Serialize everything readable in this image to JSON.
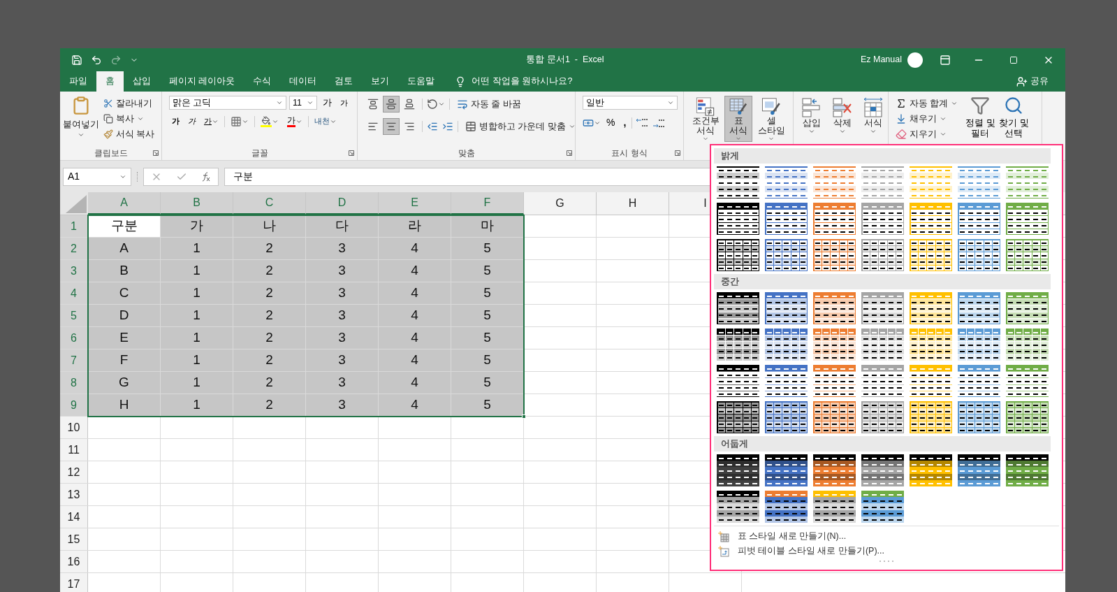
{
  "window": {
    "title": "통합 문서1  -  Excel",
    "user": "Ez Manual"
  },
  "tabs": [
    {
      "label": "파일",
      "selected": false
    },
    {
      "label": "홈",
      "selected": true
    },
    {
      "label": "삽입",
      "selected": false
    },
    {
      "label": "페이지 레이아웃",
      "selected": false
    },
    {
      "label": "수식",
      "selected": false
    },
    {
      "label": "데이터",
      "selected": false
    },
    {
      "label": "검토",
      "selected": false
    },
    {
      "label": "보기",
      "selected": false
    },
    {
      "label": "도움말",
      "selected": false
    }
  ],
  "tell_me": "어떤 작업을 원하시나요?",
  "share": "공유",
  "clipboard": {
    "label": "클립보드",
    "paste": "붙여넣기",
    "cut": "잘라내기",
    "copy": "복사",
    "format_painter": "서식 복사"
  },
  "font": {
    "label": "글꼴",
    "name": "맑은 고딕",
    "size": "11",
    "grow": "가",
    "shrink": "가",
    "bold": "가",
    "italic": "가",
    "underline": "가",
    "font_color": "가",
    "phonetic": "내천"
  },
  "alignment": {
    "label": "맞춤",
    "vertical": [
      {
        "kind": "top",
        "selected": false
      },
      {
        "kind": "middle",
        "selected": true
      },
      {
        "kind": "bottom",
        "selected": false
      }
    ],
    "horizontal": [
      {
        "kind": "left",
        "selected": false
      },
      {
        "kind": "center",
        "selected": true
      },
      {
        "kind": "right",
        "selected": false
      }
    ],
    "wrap": "자동 줄 바꿈",
    "merge": "병합하고 가운데 맞춤"
  },
  "number": {
    "label": "표시 형식",
    "format": "일반",
    "percent": "%",
    "comma": ","
  },
  "styles": [
    {
      "kind": "conditional",
      "label": "조건부 서식",
      "selected": false
    },
    {
      "kind": "table",
      "label": "표 서식",
      "selected": true
    },
    {
      "kind": "cell",
      "label": "셀 스타일",
      "selected": false
    }
  ],
  "cells": [
    {
      "kind": "insert",
      "label": "삽입"
    },
    {
      "kind": "delete",
      "label": "삭제"
    },
    {
      "kind": "format",
      "label": "서식"
    }
  ],
  "editing": {
    "autosum": "자동 합계",
    "fill": "채우기",
    "clear": "지우기",
    "sort": "정렬 및 필터",
    "find": "찾기 및 선택"
  },
  "name_box": "A1",
  "formula": "구분",
  "sheet": {
    "columns": [
      {
        "label": "A",
        "selected": true
      },
      {
        "label": "B",
        "selected": true
      },
      {
        "label": "C",
        "selected": true
      },
      {
        "label": "D",
        "selected": true
      },
      {
        "label": "E",
        "selected": true
      },
      {
        "label": "F",
        "selected": true
      },
      {
        "label": "G",
        "selected": false
      },
      {
        "label": "H",
        "selected": false
      },
      {
        "label": "I",
        "selected": false
      }
    ],
    "rows": [
      {
        "header": "1",
        "selected": true,
        "cells": [
          "구분",
          "가",
          "나",
          "다",
          "라",
          "마"
        ]
      },
      {
        "header": "2",
        "selected": true,
        "cells": [
          "A",
          "1",
          "2",
          "3",
          "4",
          "5"
        ]
      },
      {
        "header": "3",
        "selected": true,
        "cells": [
          "B",
          "1",
          "2",
          "3",
          "4",
          "5"
        ]
      },
      {
        "header": "4",
        "selected": true,
        "cells": [
          "C",
          "1",
          "2",
          "3",
          "4",
          "5"
        ]
      },
      {
        "header": "5",
        "selected": true,
        "cells": [
          "D",
          "1",
          "2",
          "3",
          "4",
          "5"
        ]
      },
      {
        "header": "6",
        "selected": true,
        "cells": [
          "E",
          "1",
          "2",
          "3",
          "4",
          "5"
        ]
      },
      {
        "header": "7",
        "selected": true,
        "cells": [
          "F",
          "1",
          "2",
          "3",
          "4",
          "5"
        ]
      },
      {
        "header": "8",
        "selected": true,
        "cells": [
          "G",
          "1",
          "2",
          "3",
          "4",
          "5"
        ]
      },
      {
        "header": "9",
        "selected": true,
        "cells": [
          "H",
          "1",
          "2",
          "3",
          "4",
          "5"
        ]
      },
      {
        "header": "10",
        "selected": false
      },
      {
        "header": "11",
        "selected": false
      },
      {
        "header": "12",
        "selected": false
      },
      {
        "header": "13",
        "selected": false
      },
      {
        "header": "14",
        "selected": false
      },
      {
        "header": "15",
        "selected": false
      },
      {
        "header": "16",
        "selected": false
      },
      {
        "header": "17",
        "selected": false
      }
    ]
  },
  "gallery": {
    "sections": [
      {
        "title": "밝게",
        "styles": [
          {
            "kind": "light-banded",
            "color": "#000000"
          },
          {
            "kind": "light-banded",
            "color": "#4472c4"
          },
          {
            "kind": "light-banded",
            "color": "#ed7d31"
          },
          {
            "kind": "light-banded",
            "color": "#a5a5a5"
          },
          {
            "kind": "light-banded",
            "color": "#ffc000"
          },
          {
            "kind": "light-banded",
            "color": "#5b9bd5"
          },
          {
            "kind": "light-banded",
            "color": "#70ad47"
          },
          {
            "kind": "light-header",
            "color": "#000000"
          },
          {
            "kind": "light-header",
            "color": "#4472c4"
          },
          {
            "kind": "light-header",
            "color": "#ed7d31"
          },
          {
            "kind": "light-header",
            "color": "#a5a5a5"
          },
          {
            "kind": "light-header",
            "color": "#ffc000"
          },
          {
            "kind": "light-header",
            "color": "#5b9bd5"
          },
          {
            "kind": "light-header",
            "color": "#70ad47"
          },
          {
            "kind": "light-grid",
            "color": "#000000"
          },
          {
            "kind": "light-grid",
            "color": "#4472c4"
          },
          {
            "kind": "light-grid",
            "color": "#ed7d31"
          },
          {
            "kind": "light-grid",
            "color": "#a5a5a5"
          },
          {
            "kind": "light-grid",
            "color": "#ffc000"
          },
          {
            "kind": "light-grid",
            "color": "#5b9bd5"
          },
          {
            "kind": "light-grid",
            "color": "#70ad47"
          }
        ]
      },
      {
        "title": "중간",
        "styles": [
          {
            "kind": "medium-banded",
            "color": "#000000"
          },
          {
            "kind": "medium-banded",
            "color": "#4472c4"
          },
          {
            "kind": "medium-banded",
            "color": "#ed7d31"
          },
          {
            "kind": "medium-banded",
            "color": "#a5a5a5"
          },
          {
            "kind": "medium-banded",
            "color": "#ffc000"
          },
          {
            "kind": "medium-banded",
            "color": "#5b9bd5"
          },
          {
            "kind": "medium-banded",
            "color": "#70ad47"
          },
          {
            "kind": "medium-grid",
            "color": "#000000"
          },
          {
            "kind": "medium-grid",
            "color": "#4472c4"
          },
          {
            "kind": "medium-grid",
            "color": "#ed7d31"
          },
          {
            "kind": "medium-grid",
            "color": "#a5a5a5"
          },
          {
            "kind": "medium-grid",
            "color": "#ffc000"
          },
          {
            "kind": "medium-grid",
            "color": "#5b9bd5"
          },
          {
            "kind": "medium-grid",
            "color": "#70ad47"
          },
          {
            "kind": "medium-lines",
            "color": "#000000"
          },
          {
            "kind": "medium-lines",
            "color": "#4472c4"
          },
          {
            "kind": "medium-lines",
            "color": "#ed7d31"
          },
          {
            "kind": "medium-lines",
            "color": "#a5a5a5"
          },
          {
            "kind": "medium-lines",
            "color": "#ffc000"
          },
          {
            "kind": "medium-lines",
            "color": "#5b9bd5"
          },
          {
            "kind": "medium-lines",
            "color": "#70ad47"
          },
          {
            "kind": "medium-tinted",
            "color": "#000000"
          },
          {
            "kind": "medium-tinted",
            "color": "#4472c4"
          },
          {
            "kind": "medium-tinted",
            "color": "#ed7d31"
          },
          {
            "kind": "medium-tinted",
            "color": "#a5a5a5"
          },
          {
            "kind": "medium-tinted",
            "color": "#ffc000"
          },
          {
            "kind": "medium-tinted",
            "color": "#5b9bd5"
          },
          {
            "kind": "medium-tinted",
            "color": "#70ad47"
          }
        ]
      },
      {
        "title": "어둡게",
        "styles": [
          {
            "kind": "dark-banded",
            "color": "#404040"
          },
          {
            "kind": "dark-banded",
            "color": "#4472c4"
          },
          {
            "kind": "dark-banded",
            "color": "#ed7d31"
          },
          {
            "kind": "dark-banded",
            "color": "#a5a5a5"
          },
          {
            "kind": "dark-banded",
            "color": "#ffc000"
          },
          {
            "kind": "dark-banded",
            "color": "#5b9bd5"
          },
          {
            "kind": "dark-banded",
            "color": "#70ad47"
          },
          {
            "kind": "dark-contrast",
            "color": "#000000",
            "band": {
              "color": "#a5a5a5"
            }
          },
          {
            "kind": "dark-contrast",
            "color": "#ed7d31",
            "band": {
              "color": "#4472c4"
            }
          },
          {
            "kind": "dark-contrast",
            "color": "#ffc000",
            "band": {
              "color": "#a5a5a5"
            }
          },
          {
            "kind": "dark-contrast",
            "color": "#70ad47",
            "band": {
              "color": "#5b9bd5"
            }
          }
        ]
      }
    ],
    "commands": [
      {
        "kind": "table",
        "label": "표 스타일 새로 만들기(N)..."
      },
      {
        "kind": "pivot",
        "label": "피벗 테이블 스타일 새로 만들기(P)..."
      }
    ]
  }
}
